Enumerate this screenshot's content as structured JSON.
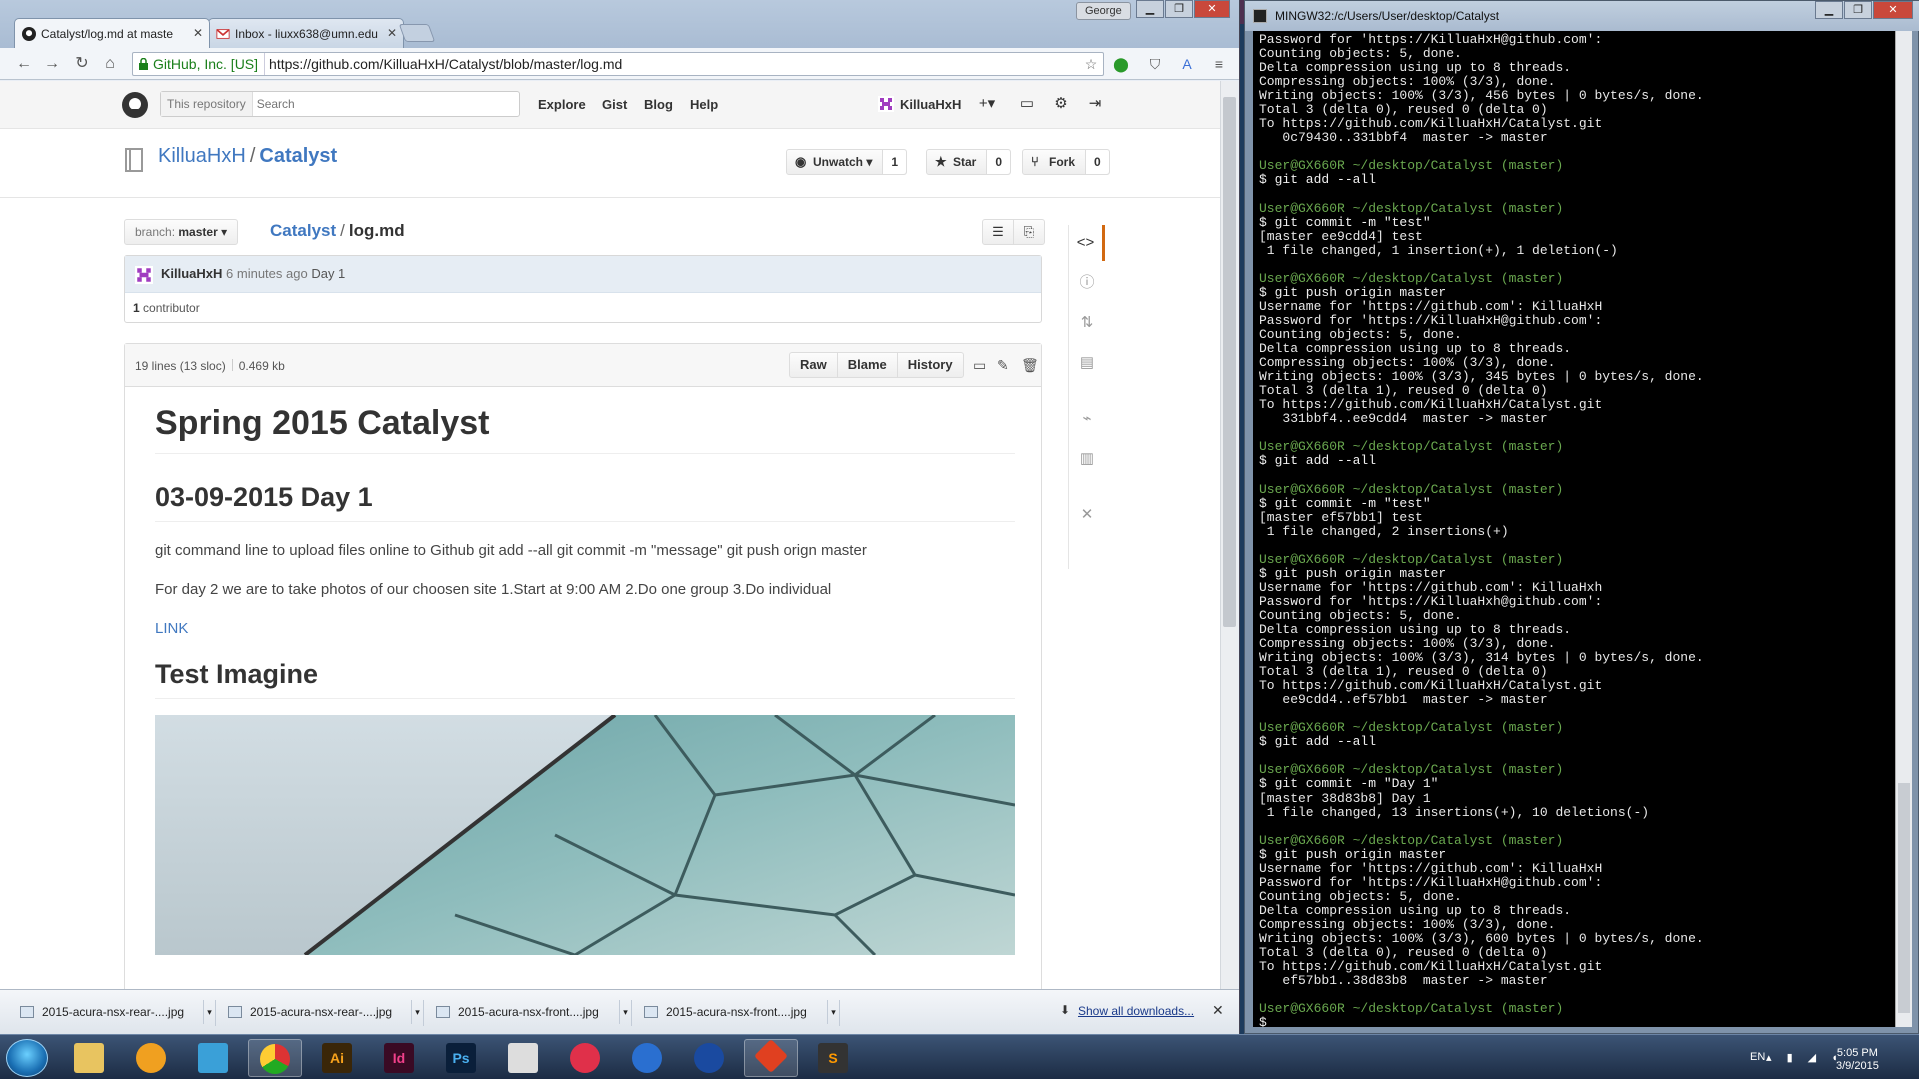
{
  "browser": {
    "tabs": [
      {
        "title": "Catalyst/log.md at maste",
        "active": true
      },
      {
        "title": "Inbox - liuxx638@umn.edu",
        "active": false
      }
    ],
    "user_name": "George",
    "ev_label": "GitHub, Inc. [US]",
    "url": "https://github.com/KilluaHxH/Catalyst/blob/master/log.md"
  },
  "github": {
    "search_scope": "This repository",
    "search_placeholder": "Search",
    "nav": [
      "Explore",
      "Gist",
      "Blog",
      "Help"
    ],
    "username": "KilluaHxH",
    "repo_owner": "KilluaHxH",
    "repo_sep": "/",
    "repo_name": "Catalyst",
    "unwatch_label": "Unwatch",
    "unwatch_count": "1",
    "star_label": "Star",
    "star_count": "0",
    "fork_label": "Fork",
    "fork_count": "0",
    "branch_prefix": "branch:",
    "branch_name": "master",
    "breadcrumb_repo": "Catalyst",
    "breadcrumb_sep": "/",
    "breadcrumb_file": "log.md",
    "commit_author": "KilluaHxH",
    "commit_ago": "6 minutes ago",
    "commit_message": "Day 1",
    "contributor_count": "1",
    "contributor_label": "contributor",
    "file_lines": "19 lines (13 sloc)",
    "file_size": "0.469 kb",
    "file_buttons": [
      "Raw",
      "Blame",
      "History"
    ]
  },
  "readme": {
    "h1": "Spring 2015 Catalyst",
    "h2_day": "03-09-2015 Day 1",
    "p1": "git command line to upload files online to Github git add --all git commit -m \"message\" git push orign master",
    "p2": "For day 2 we are to take photos of our choosen site 1.Start at 9:00 AM 2.Do one group 3.Do individual",
    "link": "LINK",
    "h2_test": "Test Imagine"
  },
  "downloads": {
    "items": [
      "2015-acura-nsx-rear-....jpg",
      "2015-acura-nsx-rear-....jpg",
      "2015-acura-nsx-front....jpg",
      "2015-acura-nsx-front....jpg"
    ],
    "show_all": "Show all downloads..."
  },
  "terminal": {
    "title": "MINGW32:/c/Users/User/desktop/Catalyst",
    "lines": [
      {
        "t": "out",
        "s": "Password for 'https://KilluaHxH@github.com':"
      },
      {
        "t": "out",
        "s": "Counting objects: 5, done."
      },
      {
        "t": "out",
        "s": "Delta compression using up to 8 threads."
      },
      {
        "t": "out",
        "s": "Compressing objects: 100% (3/3), done."
      },
      {
        "t": "out",
        "s": "Writing objects: 100% (3/3), 456 bytes | 0 bytes/s, done."
      },
      {
        "t": "out",
        "s": "Total 3 (delta 0), reused 0 (delta 0)"
      },
      {
        "t": "out",
        "s": "To https://github.com/KilluaHxH/Catalyst.git"
      },
      {
        "t": "out",
        "s": "   0c79430..331bbf4  master -> master"
      },
      {
        "t": "out",
        "s": ""
      },
      {
        "t": "prompt",
        "s": "User@GX660R ~/desktop/Catalyst (master)"
      },
      {
        "t": "cmd",
        "s": "$ git add --all"
      },
      {
        "t": "out",
        "s": ""
      },
      {
        "t": "prompt",
        "s": "User@GX660R ~/desktop/Catalyst (master)"
      },
      {
        "t": "cmd",
        "s": "$ git commit -m \"test\""
      },
      {
        "t": "out",
        "s": "[master ee9cdd4] test"
      },
      {
        "t": "out",
        "s": " 1 file changed, 1 insertion(+), 1 deletion(-)"
      },
      {
        "t": "out",
        "s": ""
      },
      {
        "t": "prompt",
        "s": "User@GX660R ~/desktop/Catalyst (master)"
      },
      {
        "t": "cmd",
        "s": "$ git push origin master"
      },
      {
        "t": "out",
        "s": "Username for 'https://github.com': KilluaHxH"
      },
      {
        "t": "out",
        "s": "Password for 'https://KilluaHxH@github.com':"
      },
      {
        "t": "out",
        "s": "Counting objects: 5, done."
      },
      {
        "t": "out",
        "s": "Delta compression using up to 8 threads."
      },
      {
        "t": "out",
        "s": "Compressing objects: 100% (3/3), done."
      },
      {
        "t": "out",
        "s": "Writing objects: 100% (3/3), 345 bytes | 0 bytes/s, done."
      },
      {
        "t": "out",
        "s": "Total 3 (delta 1), reused 0 (delta 0)"
      },
      {
        "t": "out",
        "s": "To https://github.com/KilluaHxH/Catalyst.git"
      },
      {
        "t": "out",
        "s": "   331bbf4..ee9cdd4  master -> master"
      },
      {
        "t": "out",
        "s": ""
      },
      {
        "t": "prompt",
        "s": "User@GX660R ~/desktop/Catalyst (master)"
      },
      {
        "t": "cmd",
        "s": "$ git add --all"
      },
      {
        "t": "out",
        "s": ""
      },
      {
        "t": "prompt",
        "s": "User@GX660R ~/desktop/Catalyst (master)"
      },
      {
        "t": "cmd",
        "s": "$ git commit -m \"test\""
      },
      {
        "t": "out",
        "s": "[master ef57bb1] test"
      },
      {
        "t": "out",
        "s": " 1 file changed, 2 insertions(+)"
      },
      {
        "t": "out",
        "s": ""
      },
      {
        "t": "prompt",
        "s": "User@GX660R ~/desktop/Catalyst (master)"
      },
      {
        "t": "cmd",
        "s": "$ git push origin master"
      },
      {
        "t": "out",
        "s": "Username for 'https://github.com': KilluaHxh"
      },
      {
        "t": "out",
        "s": "Password for 'https://KilluaHxh@github.com':"
      },
      {
        "t": "out",
        "s": "Counting objects: 5, done."
      },
      {
        "t": "out",
        "s": "Delta compression using up to 8 threads."
      },
      {
        "t": "out",
        "s": "Compressing objects: 100% (3/3), done."
      },
      {
        "t": "out",
        "s": "Writing objects: 100% (3/3), 314 bytes | 0 bytes/s, done."
      },
      {
        "t": "out",
        "s": "Total 3 (delta 1), reused 0 (delta 0)"
      },
      {
        "t": "out",
        "s": "To https://github.com/KilluaHxH/Catalyst.git"
      },
      {
        "t": "out",
        "s": "   ee9cdd4..ef57bb1  master -> master"
      },
      {
        "t": "out",
        "s": ""
      },
      {
        "t": "prompt",
        "s": "User@GX660R ~/desktop/Catalyst (master)"
      },
      {
        "t": "cmd",
        "s": "$ git add --all"
      },
      {
        "t": "out",
        "s": ""
      },
      {
        "t": "prompt",
        "s": "User@GX660R ~/desktop/Catalyst (master)"
      },
      {
        "t": "cmd",
        "s": "$ git commit -m \"Day 1\""
      },
      {
        "t": "out",
        "s": "[master 38d83b8] Day 1"
      },
      {
        "t": "out",
        "s": " 1 file changed, 13 insertions(+), 10 deletions(-)"
      },
      {
        "t": "out",
        "s": ""
      },
      {
        "t": "prompt",
        "s": "User@GX660R ~/desktop/Catalyst (master)"
      },
      {
        "t": "cmd",
        "s": "$ git push origin master"
      },
      {
        "t": "out",
        "s": "Username for 'https://github.com': KilluaHxH"
      },
      {
        "t": "out",
        "s": "Password for 'https://KilluaHxH@github.com':"
      },
      {
        "t": "out",
        "s": "Counting objects: 5, done."
      },
      {
        "t": "out",
        "s": "Delta compression using up to 8 threads."
      },
      {
        "t": "out",
        "s": "Compressing objects: 100% (3/3), done."
      },
      {
        "t": "out",
        "s": "Writing objects: 100% (3/3), 600 bytes | 0 bytes/s, done."
      },
      {
        "t": "out",
        "s": "Total 3 (delta 0), reused 0 (delta 0)"
      },
      {
        "t": "out",
        "s": "To https://github.com/KilluaHxH/Catalyst.git"
      },
      {
        "t": "out",
        "s": "   ef57bb1..38d83b8  master -> master"
      },
      {
        "t": "out",
        "s": ""
      },
      {
        "t": "prompt",
        "s": "User@GX660R ~/desktop/Catalyst (master)"
      },
      {
        "t": "cmd",
        "s": "$"
      }
    ]
  },
  "taskbar": {
    "apps": [
      "Ai",
      "Id",
      "Ps"
    ],
    "lang": "EN",
    "time": "5:05 PM",
    "date": "3/9/2015"
  },
  "colors": {
    "link_blue": "#4078c0",
    "prompt_green": "#6aa84f",
    "ev_green": "#1a7f1a",
    "selected_tab_orange": "#d26911"
  }
}
